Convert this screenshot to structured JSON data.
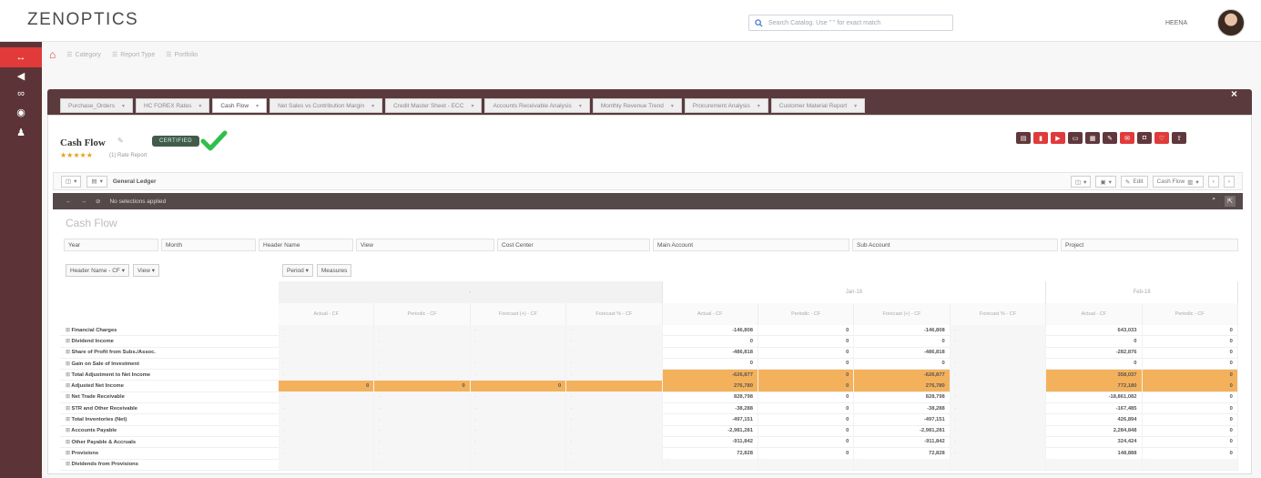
{
  "app": {
    "logo": "ZENOPTICS",
    "search_placeholder": "Search Catalog. Use \" \" for exact match",
    "username": "HEENA"
  },
  "breadcrumb": {
    "items": [
      "Category",
      "Report Type",
      "Portfolio"
    ]
  },
  "tabs": [
    {
      "label": "Purchase_Orders",
      "active": false
    },
    {
      "label": "HC FOREX Rates",
      "active": false
    },
    {
      "label": "Cash Flow",
      "active": true
    },
    {
      "label": "Net Sales vs Contribution Margin",
      "active": false
    },
    {
      "label": "Credit Master Sheet - ECC",
      "active": false
    },
    {
      "label": "Accounts Receivable Analysis",
      "active": false
    },
    {
      "label": "Monthly Revenue Trend",
      "active": false
    },
    {
      "label": "Procurement Analysis",
      "active": false
    },
    {
      "label": "Customer Material Report",
      "active": false
    }
  ],
  "report": {
    "title": "Cash Flow",
    "certified_label": "CERTIFIED",
    "rating_stars": "★★★★★",
    "subtitle": "(1) Rate Report"
  },
  "toolbar": {
    "ledger_label": "General Ledger",
    "edit_label": "Edit",
    "view_label": "Cash Flow"
  },
  "filter_bar": {
    "text": "No selections applied"
  },
  "content": {
    "title": "Cash Flow",
    "dimensions": [
      "Year",
      "Month",
      "Header Name",
      "View",
      "Cost Center",
      "Main Account",
      "Sub Account",
      "Project"
    ],
    "row_chips": [
      "Header Name - CF",
      "View"
    ],
    "col_chips": [
      "Period",
      "Measures"
    ]
  },
  "table": {
    "periods": [
      "-",
      "Jan-18",
      "Feb-18"
    ],
    "measures": [
      "Actual - CF",
      "Periodic - CF",
      "Forecast (+) - CF",
      "Forecast % - CF",
      "Actual - CF",
      "Periodic - CF",
      "Forecast (+) - CF",
      "Forecast % - CF",
      "Actual - CF",
      "Periodic - CF"
    ],
    "rows": [
      {
        "label": "Financial Charges",
        "values": [
          "-",
          "-",
          "-",
          "-",
          "-146,808",
          "0",
          "-146,808",
          "-",
          "643,033",
          "0"
        ],
        "highlight": false
      },
      {
        "label": "Dividend Income",
        "values": [
          "-",
          "-",
          "-",
          "-",
          "0",
          "0",
          "0",
          "-",
          "0",
          "0"
        ],
        "highlight": false
      },
      {
        "label": "Share of Profit from Subs./Assoc.",
        "values": [
          "-",
          "-",
          "-",
          "-",
          "-486,818",
          "0",
          "-486,818",
          "-",
          "-282,876",
          "0"
        ],
        "highlight": false
      },
      {
        "label": "Gain on Sale of Investment",
        "values": [
          "-",
          "-",
          "-",
          "-",
          "0",
          "0",
          "0",
          "-",
          "0",
          "0"
        ],
        "highlight": false
      },
      {
        "label": "Total Adjustment to Net Income",
        "values": [
          "-",
          "-",
          "-",
          "-",
          "-626,877",
          "0",
          "-626,877",
          "-",
          "358,037",
          "0"
        ],
        "highlight": true
      },
      {
        "label": "Adjusted Net Income",
        "values": [
          "0",
          "0",
          "0",
          "-",
          "276,780",
          "0",
          "276,780",
          "-",
          "772,180",
          "0"
        ],
        "highlight": true
      },
      {
        "label": "Net Trade Receivable",
        "values": [
          "-",
          "-",
          "-",
          "-",
          "828,798",
          "0",
          "828,798",
          "-",
          "-18,861,082",
          "0"
        ],
        "highlight": false
      },
      {
        "label": "STR and Other Receivable",
        "values": [
          "-",
          "-",
          "-",
          "-",
          "-38,288",
          "0",
          "-38,288",
          "-",
          "-167,485",
          "0"
        ],
        "highlight": false
      },
      {
        "label": "Total Inventories (Net)",
        "values": [
          "-",
          "-",
          "-",
          "-",
          "-497,151",
          "0",
          "-497,151",
          "-",
          "426,894",
          "0"
        ],
        "highlight": false
      },
      {
        "label": "Accounts Payable",
        "values": [
          "-",
          "-",
          "-",
          "-",
          "-2,981,281",
          "0",
          "-2,981,281",
          "-",
          "2,284,848",
          "0"
        ],
        "highlight": false
      },
      {
        "label": "Other Payable & Accruals",
        "values": [
          "-",
          "-",
          "-",
          "-",
          "-911,842",
          "0",
          "-911,842",
          "-",
          "324,424",
          "0"
        ],
        "highlight": false
      },
      {
        "label": "Provisions",
        "values": [
          "-",
          "-",
          "-",
          "-",
          "72,828",
          "0",
          "72,828",
          "-",
          "148,888",
          "0"
        ],
        "highlight": false
      },
      {
        "label": "Dividends from Provisions",
        "values": [
          "-",
          "-",
          "-",
          "-",
          "-",
          "-",
          "-",
          "-",
          "-",
          "-"
        ],
        "highlight": false
      }
    ]
  },
  "colors": {
    "sidebar": "#5c3337",
    "tabstrip": "#5b3a3d",
    "highlight": "#f4b15c",
    "certified": "#455b4a",
    "check": "#2fbf4a"
  }
}
